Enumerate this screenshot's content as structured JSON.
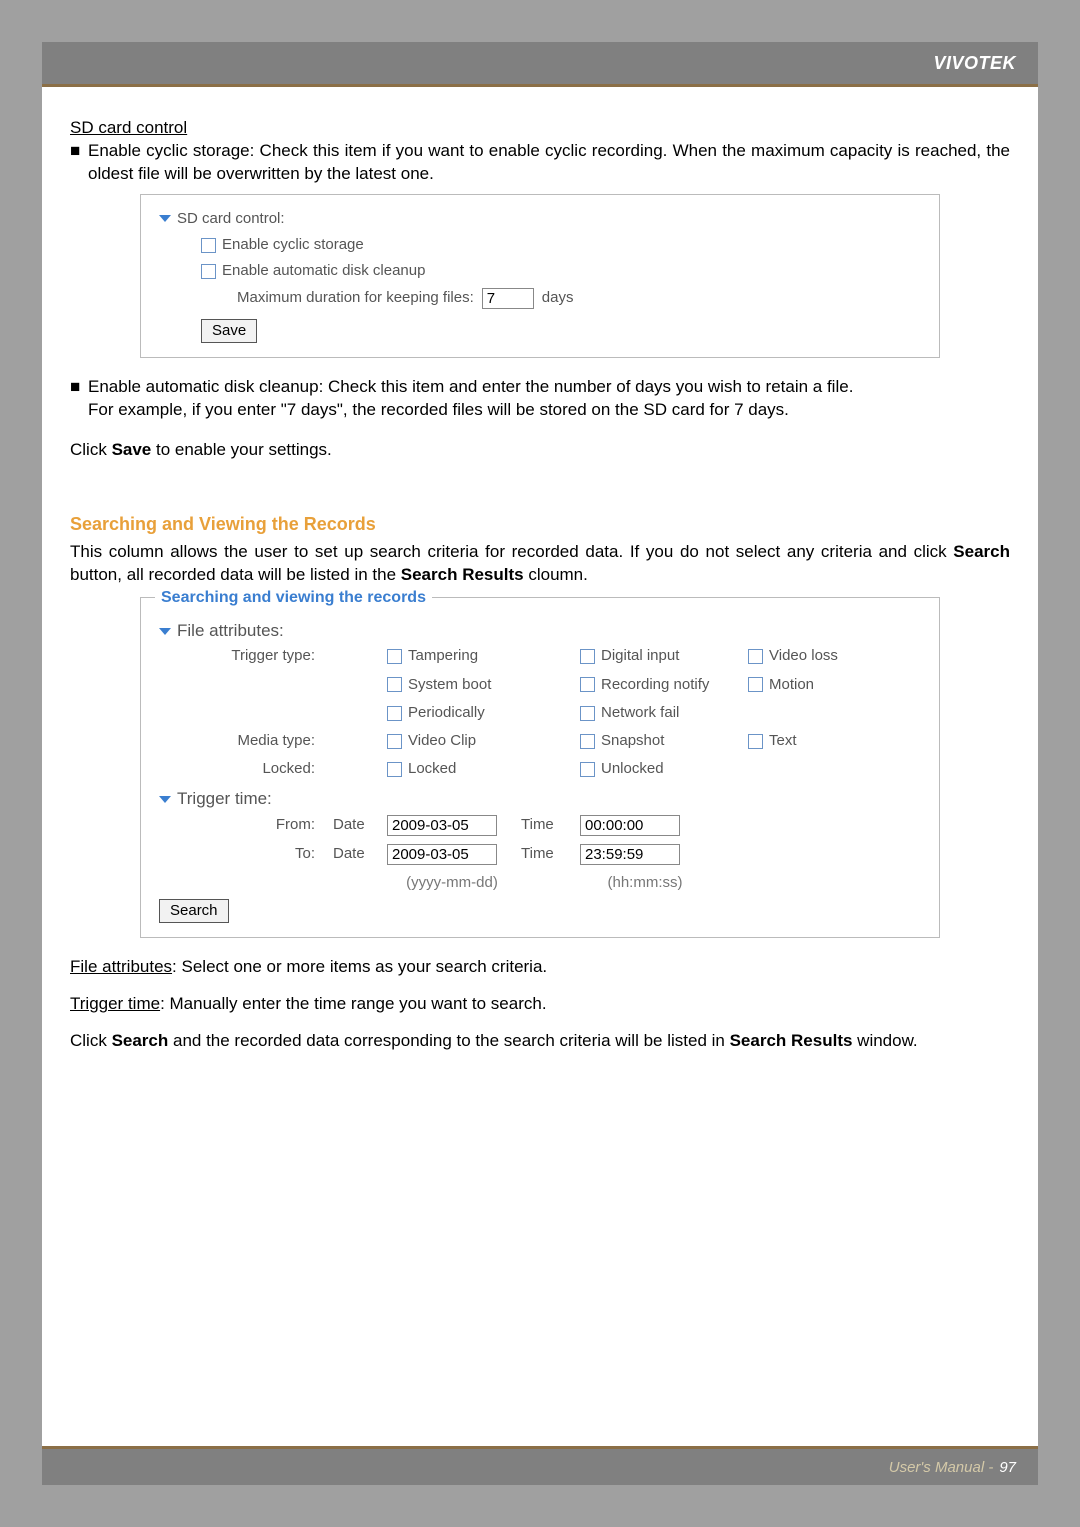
{
  "brand": "VIVOTEK",
  "sd": {
    "heading": "SD card control",
    "bullet1": "Enable cyclic storage: Check this item if you want to enable cyclic recording. When the maximum capacity is reached, the oldest file will be overwritten by the latest one.",
    "panel_title": "SD card control:",
    "opt_cyclic": "Enable cyclic storage",
    "opt_cleanup": "Enable automatic disk cleanup",
    "max_label": "Maximum duration for keeping files:",
    "max_value": "7",
    "days": "days",
    "save": "Save",
    "bullet2a": "Enable automatic disk cleanup: Check this item and enter the number of days you wish to retain a file. ",
    "bullet2b": "For example, if you enter \"7 days\", the recorded files will be stored on the SD card for 7 days.",
    "click_save_a": "Click ",
    "click_save_b": "Save",
    "click_save_c": " to enable your settings."
  },
  "srch": {
    "title": "Searching and Viewing the Records",
    "intro_a": "This column allows the user to set up search criteria for recorded data. If you do not select any criteria and click ",
    "intro_b": "Search",
    "intro_c": " button, all recorded data will be listed in the ",
    "intro_d": "Search Results",
    "intro_e": " cloumn.",
    "legend": "Searching and viewing the records",
    "file_attr": "File attributes:",
    "trigger_type": "Trigger type:",
    "t_tampering": "Tampering",
    "t_digital": "Digital input",
    "t_video": "Video loss",
    "t_system": "System boot",
    "t_record": "Recording notify",
    "t_motion": "Motion",
    "t_period": "Periodically",
    "t_network": "Network fail",
    "media_type": "Media type:",
    "m_video": "Video Clip",
    "m_snap": "Snapshot",
    "m_text": "Text",
    "locked_lbl": "Locked:",
    "l_locked": "Locked",
    "l_unlocked": "Unlocked",
    "trigger_time": "Trigger time:",
    "from": "From:",
    "to": "To:",
    "date": "Date",
    "time": "Time",
    "from_date": "2009-03-05",
    "from_time": "00:00:00",
    "to_date": "2009-03-05",
    "to_time": "23:59:59",
    "hint_date": "(yyyy-mm-dd)",
    "hint_time": "(hh:mm:ss)",
    "search_btn": "Search",
    "fa_a": "File attributes",
    "fa_b": ": Select one or more items as your search criteria.",
    "tt_a": "Trigger time",
    "tt_b": ": Manually enter the time range you want to search.",
    "out_a": "Click ",
    "out_b": "Search",
    "out_c": " and the recorded data corresponding to the search criteria will be listed in ",
    "out_d": "Search Results",
    "out_e": " window."
  },
  "footer": {
    "label": "User's Manual - ",
    "page": "97"
  }
}
